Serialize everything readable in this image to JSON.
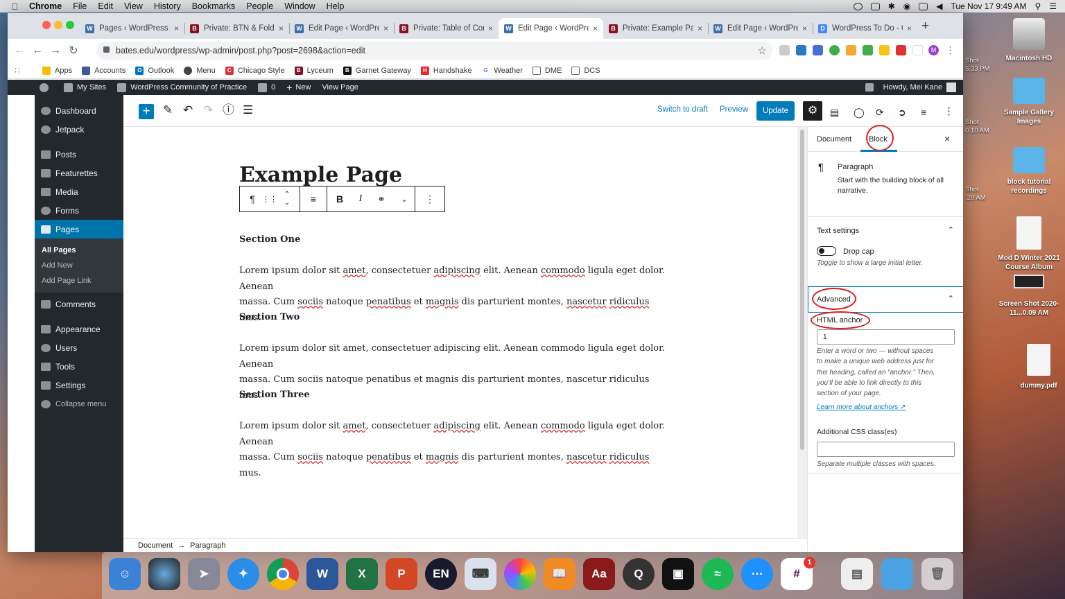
{
  "menubar": {
    "app": "Chrome",
    "items": [
      "File",
      "Edit",
      "View",
      "History",
      "Bookmarks",
      "People",
      "Window",
      "Help"
    ],
    "clock": "Tue Nov 17  9:49 AM"
  },
  "tabs": [
    {
      "title": "Pages ‹ WordPress C",
      "icon": "wordpress"
    },
    {
      "title": "Private: BTN & Folda",
      "icon": "bates"
    },
    {
      "title": "Edit Page ‹ WordPres",
      "icon": "wordpress"
    },
    {
      "title": "Private: Table of Cont",
      "icon": "bates"
    },
    {
      "title": "Edit Page ‹ WordPres",
      "icon": "wordpress"
    },
    {
      "title": "Private: Example Page",
      "icon": "bates"
    },
    {
      "title": "Edit Page ‹ WordPres",
      "icon": "wordpress"
    },
    {
      "title": "WordPress To Do - G",
      "icon": "docs"
    }
  ],
  "active_tab": 4,
  "address": "bates.edu/wordpress/wp-admin/post.php?post=2698&action=edit",
  "bookmarks": [
    "Apps",
    "Accounts",
    "Outlook",
    "Menu",
    "Chicago Style",
    "Lyceum",
    "Garnet Gateway",
    "Handshake",
    "Weather",
    "DME",
    "DCS"
  ],
  "adminbar": {
    "my_sites": "My Sites",
    "site": "WordPress Community of Practice",
    "comments": "0",
    "new": "New",
    "view": "View Page",
    "howdy": "Howdy, Mei Kane"
  },
  "sidebar": {
    "items": [
      "Dashboard",
      "Jetpack",
      "Posts",
      "Featurettes",
      "Media",
      "Forms",
      "Pages",
      "Comments",
      "Appearance",
      "Users",
      "Tools",
      "Settings",
      "Collapse menu"
    ],
    "sub": [
      "All Pages",
      "Add New",
      "Add Page Link"
    ]
  },
  "header": {
    "switch_draft": "Switch to draft",
    "preview": "Preview",
    "update": "Update"
  },
  "content": {
    "title": "Example Page",
    "sections": [
      {
        "heading": "Section One",
        "line1a": "Lorem ipsum dolor sit ",
        "w1": "amet",
        ", consectetuer ": "",
        "line1b": ", consectetuer ",
        "w2": "adipiscing",
        "line1c": " elit. Aenean ",
        "w3": "commodo",
        "line1d": " ligula eget dolor. Aenean",
        "line2a": "massa. Cum ",
        "w4": "sociis",
        "line2b": " natoque ",
        "w5": "penatibus",
        "line2c": " et ",
        "w6": "magnis",
        "line2d": " dis parturient montes, ",
        "w7": "nascetur",
        "line2e": " ",
        "w8": "ridiculus",
        "line2f": " mus."
      },
      {
        "heading": "Section Two",
        "line1": "Lorem ipsum dolor sit amet, consectetuer adipiscing elit. Aenean commodo ligula eget dolor. Aenean",
        "line2": "massa. Cum sociis natoque penatibus et magnis dis parturient montes, nascetur ridiculus mus."
      },
      {
        "heading": "Section Three",
        "line1a": "Lorem ipsum dolor sit ",
        "w1": "amet",
        "line1b": ", consectetuer ",
        "w2": "adipiscing",
        "line1c": " elit. Aenean ",
        "w3": "commodo",
        "line1d": " ligula eget dolor. Aenean",
        "line2a": "massa. Cum ",
        "w4": "sociis",
        "line2b": " natoque ",
        "w5": "penatibus",
        "line2c": " et ",
        "w6": "magnis",
        "line2d": " dis parturient montes, ",
        "w7": "nascetur",
        "line2e": " ",
        "w8": "ridiculus",
        "line2f": " mus."
      }
    ],
    "breadcrumb": {
      "doc": "Document",
      "arrow": "→",
      "block": "Paragraph"
    }
  },
  "panel": {
    "tab_document": "Document",
    "tab_block": "Block",
    "block_name": "Paragraph",
    "block_desc1": "Start with the building block of all",
    "block_desc2": "narrative.",
    "text_settings": "Text settings",
    "drop_cap": "Drop cap",
    "drop_cap_help": "Toggle to show a large initial letter.",
    "advanced": "Advanced",
    "html_anchor": "HTML anchor",
    "anchor_value": "1",
    "anchor_help": [
      "Enter a word or two — without spaces",
      "to make a unique web address just for",
      "this heading, called an “anchor.” Then,",
      "you’ll be able to link directly to this",
      "section of your page."
    ],
    "learn_more": "Learn more about anchors",
    "css_label": "Additional CSS class(es)",
    "css_value": "",
    "css_help": "Separate multiple classes with spaces."
  },
  "desktop": {
    "icons": [
      "Macintosh HD",
      "Sample Gallery Images",
      "block tutorial recordings",
      "Mod D Winter 2021 Course Album",
      "Screen Shot 2020-11...0.09 AM",
      "dummy.pdf"
    ],
    "shots": [
      "Shot",
      "5.33 PM",
      "Shot",
      "0.10 AM",
      "Shot",
      ".28 AM"
    ],
    "mail_badge": "1"
  },
  "colors": {
    "wp_blue": "#007cba",
    "admin_dark": "#23282d",
    "highlight_red": "#e01b1b"
  }
}
